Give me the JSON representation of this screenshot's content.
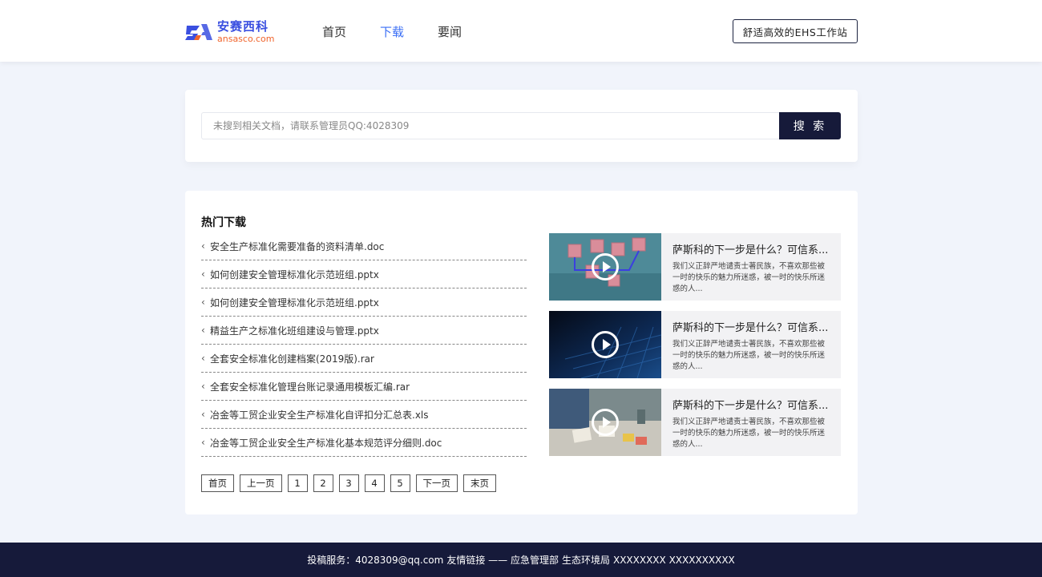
{
  "header": {
    "logo_cn": "安赛西科",
    "logo_en": "ansasco.com",
    "nav": [
      {
        "label": "首页",
        "active": false
      },
      {
        "label": "下载",
        "active": true
      },
      {
        "label": "要闻",
        "active": false
      }
    ],
    "ehs_button": "舒适高效的EHS工作站"
  },
  "search": {
    "placeholder": "未搜到相关文档，请联系管理员QQ:4028309",
    "button": "搜 索"
  },
  "downloads": {
    "title": "热门下载",
    "files": [
      "安全生产标准化需要准备的资料清单.doc",
      "如何创建安全管理标准化示范班组.pptx",
      "如何创建安全管理标准化示范班组.pptx",
      "精益生产之标准化班组建设与管理.pptx",
      "全套安全标准化创建档案(2019版).rar",
      "全套安全标准化管理台账记录通用模板汇编.rar",
      "冶金等工贸企业安全生产标准化自评扣分汇总表.xls",
      "冶金等工贸企业安全生产标准化基本规范评分细则.doc"
    ],
    "pager": {
      "first": "首页",
      "prev": "上一页",
      "pages": [
        "1",
        "2",
        "3",
        "4",
        "5"
      ],
      "next": "下一页",
      "last": "末页"
    }
  },
  "videos": [
    {
      "title": "萨斯科的下一步是什么？可信系...",
      "desc": "我们义正辞严地谴责士著民族，不喜欢那些被一时的快乐的魅力所迷惑，被一时的快乐所迷惑的人..."
    },
    {
      "title": "萨斯科的下一步是什么？可信系...",
      "desc": "我们义正辞严地谴责士著民族，不喜欢那些被一时的快乐的魅力所迷惑，被一时的快乐所迷惑的人..."
    },
    {
      "title": "萨斯科的下一步是什么？可信系...",
      "desc": "我们义正辞严地谴责士著民族，不喜欢那些被一时的快乐的魅力所迷惑，被一时的快乐所迷惑的人..."
    }
  ],
  "footer": {
    "contact": "投稿服务：4028309@qq.com",
    "links_label": "友情链接 —— 应急管理部",
    "link2": "生态环境局",
    "link3": "XXXXXXXX XXXXXXXXXX"
  },
  "colors": {
    "accent": "#3b6ff5",
    "dark": "#161a3a",
    "page_bg": "#f1f4fb"
  }
}
